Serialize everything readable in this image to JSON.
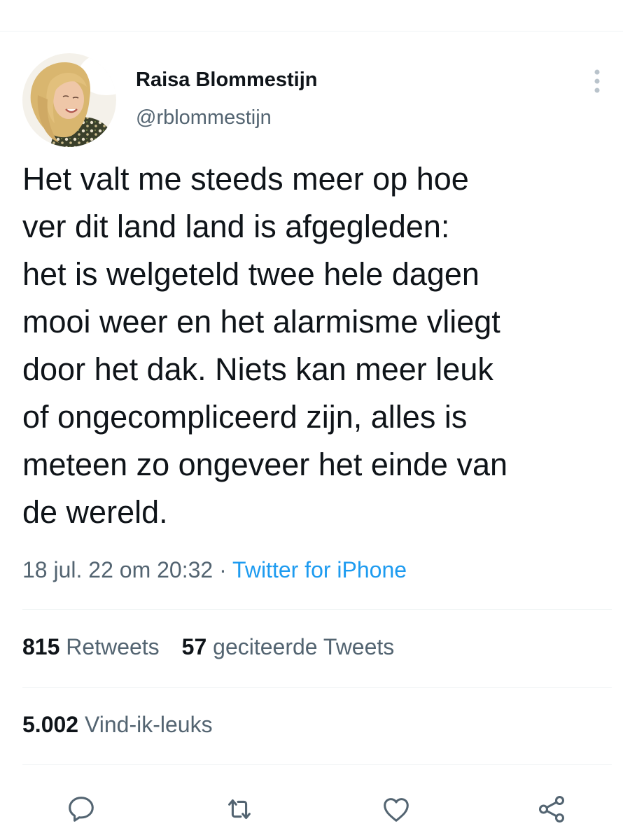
{
  "tweet": {
    "author": {
      "display_name": "Raisa Blommestijn",
      "handle": "@rblommestijn"
    },
    "text": "Het valt me steeds meer op hoe\nver dit land land is afgegleden:\nhet is welgeteld twee hele dagen\nmooi weer en het alarmisme vliegt\ndoor het dak. Niets kan meer leuk\nof ongecompliceerd zijn, alles is\nmeteen zo ongeveer het einde van\nde wereld.",
    "timestamp": "18 jul. 22 om 20:32",
    "separator": " · ",
    "source": "Twitter for iPhone"
  },
  "stats": {
    "retweets_count": "815",
    "retweets_label": "Retweets",
    "quotes_count": "57",
    "quotes_label": "geciteerde Tweets",
    "likes_count": "5.002",
    "likes_label": "Vind-ik-leuks"
  },
  "icons": {
    "more": "more-vertical-icon",
    "reply": "reply-icon",
    "retweet": "retweet-icon",
    "like": "heart-icon",
    "share": "share-icon"
  },
  "colors": {
    "text_primary": "#0f1419",
    "text_secondary": "#536471",
    "accent": "#1d9bf0",
    "divider": "#eff3f4"
  }
}
